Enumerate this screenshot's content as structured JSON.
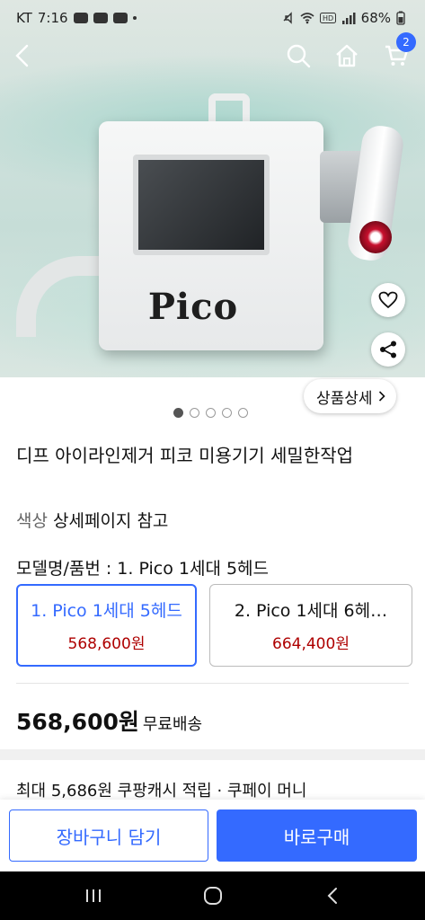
{
  "status_bar": {
    "carrier": "KT",
    "time": "7:16",
    "battery": "68%"
  },
  "nav": {
    "cart_count": "2"
  },
  "hero": {
    "device_logo": "Pico",
    "detail_chip_label": "상품상세",
    "slide_count": 5,
    "active_slide": 1
  },
  "product": {
    "title": "디프 아이라인제거 피코 미용기기 세밀한작업",
    "color_label": "색상",
    "color_value": "상세페이지 참고",
    "option_label": "모델명/품번 : 1. Pico 1세대 5헤드",
    "options": [
      {
        "name": "1. Pico 1세대 5헤드",
        "price": "568,600원",
        "selected": true
      },
      {
        "name": "2. Pico 1세대 6헤…",
        "price": "664,400원",
        "selected": false
      }
    ],
    "price": "568,600원",
    "shipping": "무료배송",
    "cashback": "최대 5,686원 쿠팡캐시 적립 · 쿠페이 머니"
  },
  "actions": {
    "add_to_cart": "장바구니 담기",
    "buy_now": "바로구매"
  },
  "colors": {
    "accent": "#346aff",
    "price_red": "#ae0000"
  },
  "icons": {
    "back": "chevron-left-icon",
    "search": "search-icon",
    "home": "home-icon",
    "cart": "cart-icon",
    "heart": "heart-icon",
    "share": "share-icon"
  }
}
